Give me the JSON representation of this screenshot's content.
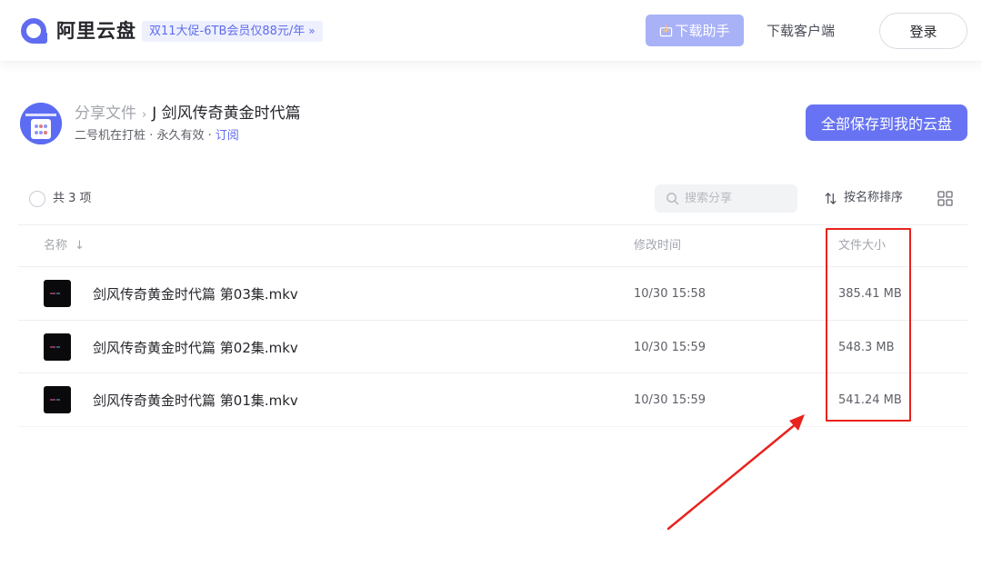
{
  "header": {
    "brand": "阿里云盘",
    "promo": "双11大促-6TB会员仅88元/年",
    "promo_chevron": "»",
    "download_helper": "下载助手",
    "download_client": "下载客户端",
    "login": "登录",
    "accent_color": "#5f6cf0"
  },
  "share": {
    "breadcrumb_root": "分享文件",
    "breadcrumb_sep": "›",
    "breadcrumb_current": "J 剑风传奇黄金时代篇",
    "owner": "二号机在打桩",
    "validity": "永久有效",
    "dot": "·",
    "subscribe": "订阅",
    "save_all": "全部保存到我的云盘"
  },
  "toolbar": {
    "count": "共 3 项",
    "search_placeholder": "搜索分享",
    "sort_label": "按名称排序"
  },
  "table": {
    "columns": {
      "name": "名称",
      "name_arrow": "↓",
      "modified": "修改时间",
      "size": "文件大小"
    },
    "rows": [
      {
        "name": "剑风传奇黄金时代篇 第03集.mkv",
        "modified": "10/30 15:58",
        "size": "385.41 MB"
      },
      {
        "name": "剑风传奇黄金时代篇 第02集.mkv",
        "modified": "10/30 15:59",
        "size": "548.3 MB"
      },
      {
        "name": "剑风传奇黄金时代篇 第01集.mkv",
        "modified": "10/30 15:59",
        "size": "541.24 MB"
      }
    ]
  },
  "annotation": {
    "color": "#e8221d"
  }
}
